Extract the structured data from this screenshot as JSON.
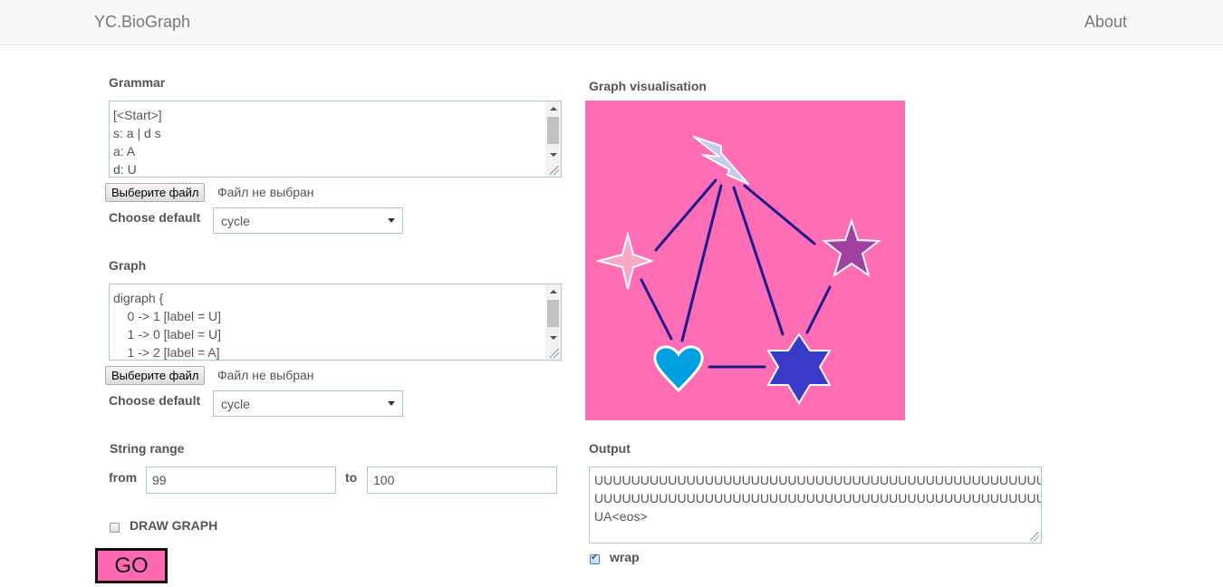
{
  "navbar": {
    "brand": "YC.BioGraph",
    "about": "About"
  },
  "grammar": {
    "label": "Grammar",
    "lines": [
      "[<Start>]",
      "s: a | d s",
      "a: A",
      "d: U"
    ],
    "file_button": "Выберите файл",
    "file_status": "Файл не выбран",
    "default_label": "Choose default",
    "default_value": "cycle"
  },
  "graph": {
    "label": "Graph",
    "lines": [
      "digraph {",
      "    0 -> 1 [label = U]",
      "    1 -> 0 [label = U]",
      "    1 -> 2 [label = A]"
    ],
    "file_button": "Выберите файл",
    "file_status": "Файл не выбран",
    "default_label": "Choose default",
    "default_value": "cycle"
  },
  "range": {
    "label": "String range",
    "from_label": "from",
    "from_value": "99",
    "to_label": "to",
    "to_value": "100"
  },
  "draw_graph": {
    "label": "DRAW GRAPH",
    "checked": false
  },
  "go_label": "GO",
  "visualisation": {
    "label": "Graph visualisation",
    "background": "#ff6eb4",
    "edge_color": "#1a1a8c",
    "nodes": [
      {
        "shape": "lightning-icon",
        "color": "#c8c8f0"
      },
      {
        "shape": "four-point-star-icon",
        "color": "#f9a8c8"
      },
      {
        "shape": "five-point-star-icon",
        "color": "#a040a0"
      },
      {
        "shape": "heart-icon",
        "color": "#00a0e0"
      },
      {
        "shape": "six-point-star-icon",
        "color": "#3a3ac8"
      }
    ]
  },
  "output": {
    "label": "Output",
    "lines": [
      "UUUUUUUUUUUUUUUUUUUUUUUUUUUUUUUUUUUUUUUUUUUUUUUUU",
      "UUUUUUUUUUUUUUUUUUUUUUUUUUUUUUUUUUUUUUUUUUUUUUUUU",
      "UA<eos>"
    ],
    "wrap_label": "wrap",
    "wrap_checked": true
  }
}
